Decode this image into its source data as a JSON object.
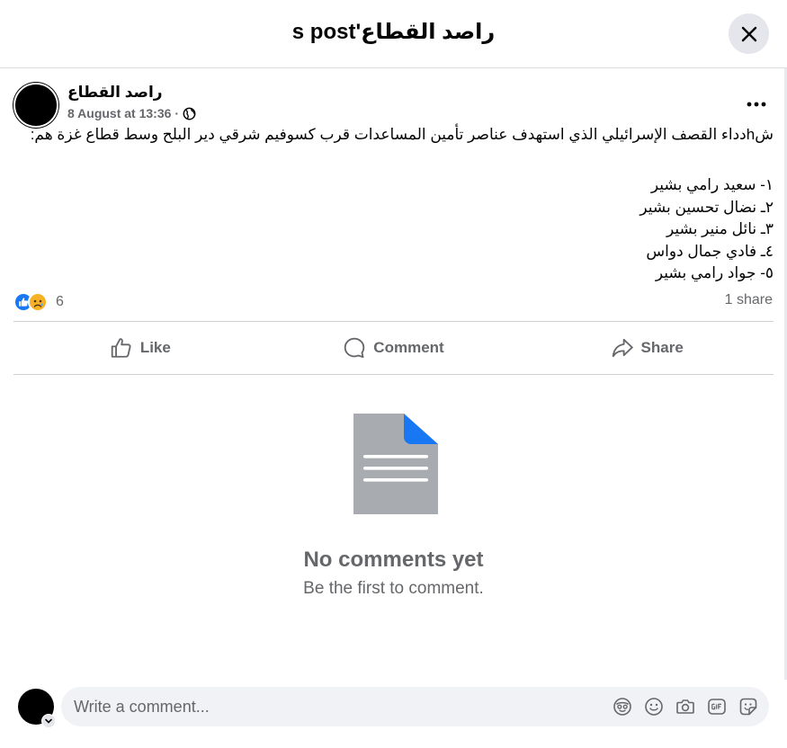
{
  "header": {
    "title": "راصد القطاع's post",
    "close_icon": "close-icon"
  },
  "post": {
    "author": "راصد القطاع",
    "date": "8 August at 13:36",
    "separator": "·",
    "audience_icon": "globe-icon",
    "more_icon": "more-horizontal-icon",
    "text": "شhدداء القصف الإسرائيلي الذي استهدف عناصر تأمين المساعدات قرب كسوفيم شرقي دير البلح وسط قطاع غزة هم:",
    "lines": [
      "١- سعيد رامي بشير",
      "٢ـ نضال تحسين بشير",
      "٣ـ نائل منير بشير",
      "٤ـ فادي جمال دواس",
      "٥- جواد رامي بشير"
    ]
  },
  "engagement": {
    "reaction_icons": [
      "like-reaction-icon",
      "sad-reaction-icon"
    ],
    "reaction_count": "6",
    "shares": "1 share"
  },
  "actions": {
    "like": "Like",
    "comment": "Comment",
    "share": "Share"
  },
  "empty_state": {
    "icon": "document-icon",
    "title": "No comments yet",
    "subtitle": "Be the first to comment."
  },
  "composer": {
    "placeholder": "Write a comment...",
    "tools": [
      "avatar-sticker-icon",
      "emoji-icon",
      "camera-icon",
      "gif-icon",
      "sticker-icon"
    ]
  },
  "colors": {
    "accent": "#1877f2",
    "secondary_text": "#65676b",
    "divider": "#ced0d4",
    "input_bg": "#f0f2f5",
    "document_gray": "#a8abaf"
  }
}
